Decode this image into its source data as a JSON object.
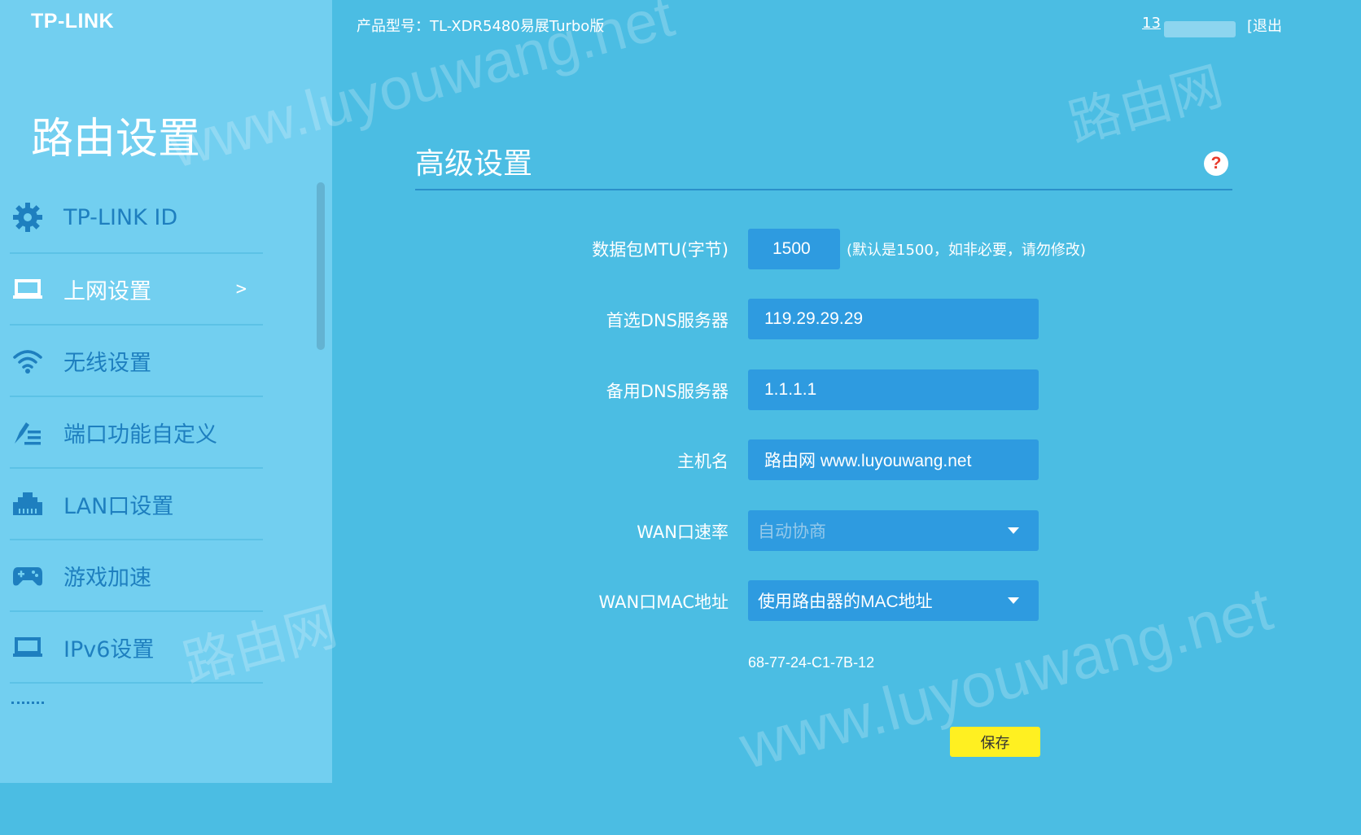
{
  "brand": {
    "logo": "TP-LINK"
  },
  "header": {
    "model": "产品型号：TL-XDR5480易展Turbo版",
    "user": "13",
    "logout": "[退出"
  },
  "sidebar": {
    "title": "路由设置",
    "items": [
      {
        "label": "TP-LINK ID",
        "icon": "gear-icon"
      },
      {
        "label": "上网设置",
        "icon": "laptop-icon",
        "active": true,
        "arrow": ">"
      },
      {
        "label": "无线设置",
        "icon": "wifi-icon"
      },
      {
        "label": "端口功能自定义",
        "icon": "edit-list-icon"
      },
      {
        "label": "LAN口设置",
        "icon": "lan-port-icon"
      },
      {
        "label": "游戏加速",
        "icon": "gamepad-icon"
      },
      {
        "label": "IPv6设置",
        "icon": "laptop-icon"
      }
    ]
  },
  "main": {
    "title": "高级设置",
    "help": "?",
    "mtu": {
      "label": "数据包MTU(字节)",
      "value": "1500",
      "hint": "(默认是1500，如非必要，请勿修改)"
    },
    "dns1": {
      "label": "首选DNS服务器",
      "value": "119.29.29.29"
    },
    "dns2": {
      "label": "备用DNS服务器",
      "value": "1.1.1.1"
    },
    "hostname": {
      "label": "主机名",
      "value": "路由网 www.luyouwang.net"
    },
    "wan_speed": {
      "label": "WAN口速率",
      "value": "自动协商"
    },
    "wan_mac": {
      "label": "WAN口MAC地址",
      "value": "使用路由器的MAC地址",
      "mac": "68-77-24-C1-7B-12"
    },
    "save": "保存"
  },
  "watermarks": [
    "www.luyouwang.net",
    "路由网",
    "路由网",
    "www.luyouwang.net"
  ],
  "colors": {
    "background": "#4bbde3",
    "sidebar": "#72cff0",
    "field": "#2e9be0",
    "save": "#fff021",
    "accent": "#1e7fbf"
  }
}
